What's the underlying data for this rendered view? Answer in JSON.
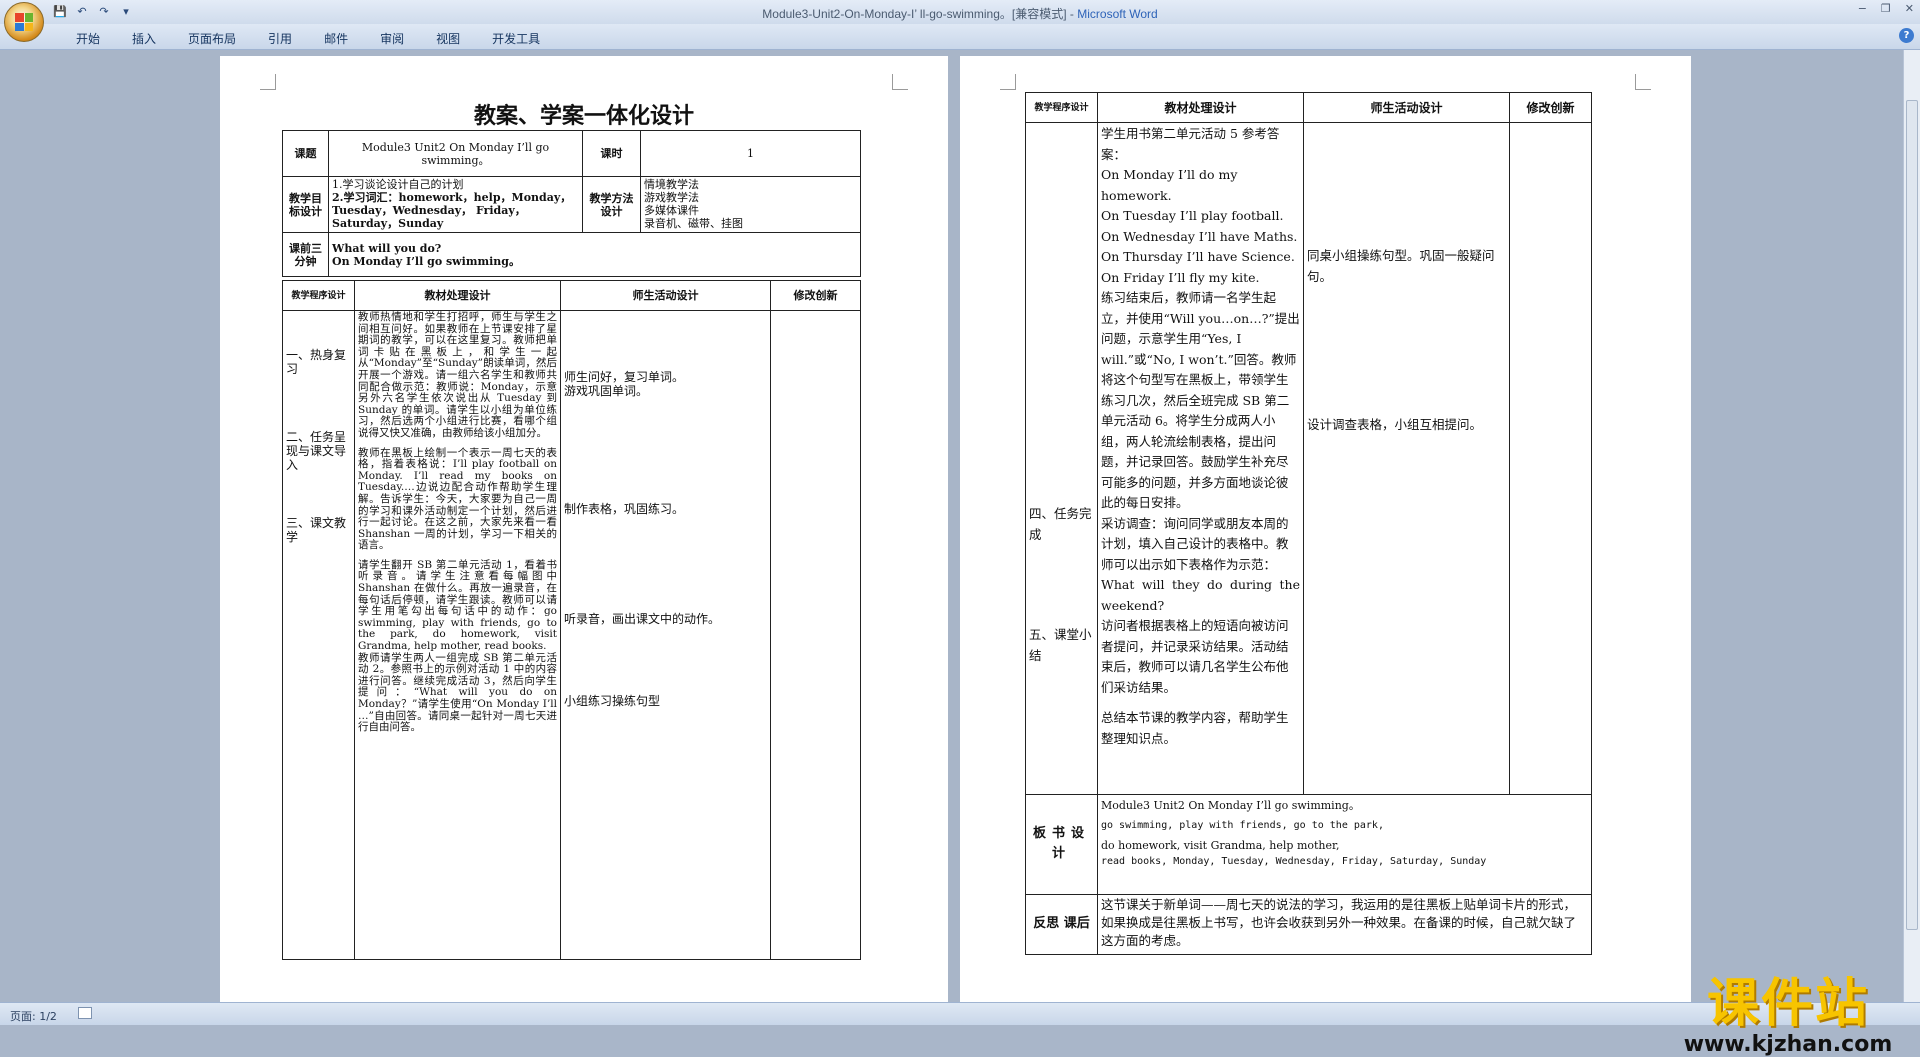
{
  "window": {
    "title": "Module3-Unit2-On-Monday-I’ ll-go-swimming。[兼容模式] - ",
    "app": "Microsoft Word",
    "controls": [
      "−",
      "❐",
      "✕"
    ]
  },
  "qat": {
    "save": "💾",
    "undo": "↶",
    "redo": "↷",
    "more": "▾"
  },
  "ribbon": {
    "tabs": [
      "开始",
      "插入",
      "页面布局",
      "引用",
      "邮件",
      "审阅",
      "视图",
      "开发工具"
    ],
    "help": "?"
  },
  "status": {
    "page": "页面: 1/2"
  },
  "page1": {
    "title": "教案、学案一体化设计",
    "row_lesson": {
      "label": "课题",
      "value": "Module3 Unit2 On Monday I’ll go swimming。",
      "hours_label": "课时",
      "hours": "1"
    },
    "row_goals": {
      "label": "教学目标设计",
      "goal1": "1.学习谈论设计自己的计划",
      "goal2": "2.学习词汇：homework，help，Monday，Tuesday，Wednesday， Friday，Saturday，Sunday",
      "method_label": "教学方法设计",
      "methods": [
        "情境教学法",
        "游戏教学法",
        "多媒体课件",
        "录音机、磁带、挂图"
      ]
    },
    "row_warm": {
      "label": "课前三分钟",
      "line1": "What will you do?",
      "line2": "On Monday I’ll go swimming。"
    },
    "headers": [
      "教学程序设计",
      "教材处理设计",
      "师生活动设计",
      "修改创新"
    ],
    "steps": [
      "一、热身复习",
      "二、任务呈现与课文导入",
      "三、课文教学"
    ],
    "content": [
      "教师热情地和学生打招呼，师生与学生之间相互问好。如果教师在上节课安排了星期词的教学，可以在这里复习。教师把单词卡贴在黑板上，和学生一起从“Monday”至“Sunday”朗读单词，然后开展一个游戏。请一组六名学生和教师共同配合做示范：教师说：Monday，示意另外六名学生依次说出从 Tuesday 到 Sunday 的单词。请学生以小组为单位练习，然后选两个小组进行比赛，看哪个组说得又快又准确，由教师给该小组加分。",
      "教师在黑板上绘制一个表示一周七天的表格，指着表格说：I’ll play football on Monday. I’ll read my books on Tuesday.…边说边配合动作帮助学生理解。告诉学生：今天，大家要为自己一周的学习和课外活动制定一个计划，然后进行一起讨论。在这之前，大家先来看一看 Shanshan 一周的计划，学习一下相关的语言。",
      "请学生翻开 SB 第二单元活动 1，看着书听录音。请学生注意看每幅图中 Shanshan 在做什么。再放一遍录音，在每句话后停顿，请学生跟读。教师可以请学生用笔勾出每句话中的动作：go swimming, play with friends, go to the park, do homework, visit Grandma, help mother, read books.",
      "教师请学生两人一组完成 SB 第二单元活动 2。参照书上的示例对活动 1 中的内容进行问答。继续完成活动 3，然后向学生提问：“What will you do on Monday？”请学生使用“On Monday I’ll …”自由回答。请同桌一起针对一周七天进行自由问答。"
    ],
    "activities": [
      "师生问好，复习单词。",
      "游戏巩固单词。",
      "制作表格，巩固练习。",
      "听录音，画出课文中的动作。",
      "小组练习操练句型"
    ]
  },
  "page2": {
    "headers": [
      "教学程序设计",
      "教材处理设计",
      "师生活动设计",
      "修改创新"
    ],
    "steps": [
      "四、任务完成",
      "五、课堂小结"
    ],
    "content_lines": [
      "学生用书第二单元活动 5 参考答案：",
      "On Monday I’ll do my homework.",
      "On Tuesday I’ll play football.",
      "On Wednesday I’ll have Maths.",
      "On Thursday I’ll have Science.",
      "On Friday I’ll fly my kite.",
      "练习结束后，教师请一名学生起立，并使用“Will you…on…?”提出问题，示意学生用“Yes, I will.”或“No, I won’t.”回答。教师将这个句型写在黑板上，带领学生练习几次，然后全班完成 SB 第二单元活动 6。将学生分成两人小组，两人轮流绘制表格，提出问题，并记录回答。鼓励学生补充尽可能多的问题，并多方面地谈论彼此的每日安排。",
      "采访调查：询问同学或朋友本周的计划，填入自己设计的表格中。教师可以出示如下表格作为示范：",
      "What will they do during the weekend?",
      "访问者根据表格上的短语向被访问者提问，并记录采访结果。活动结束后，教师可以请几名学生公布他们采访结果。",
      "总结本节课的教学内容，帮助学生整理知识点。"
    ],
    "activities": [
      "同桌小组操练句型。巩固一般疑问句。",
      "设计调查表格，小组互相提问。"
    ],
    "board_label": "板书设计",
    "board": [
      "Module3 Unit2 On Monday I’ll go swimming。",
      "go swimming, play with friends, go to the park,",
      "do homework, visit Grandma, help mother,",
      "read books, Monday, Tuesday, Wednesday, Friday, Saturday, Sunday"
    ],
    "reflect_label": "反思 课后",
    "reflect": "这节课关于新单词——周七天的说法的学习，我运用的是往黑板上贴单词卡片的形式，如果换成是往黑板上书写，也许会收获到另外一种效果。在备课的时候，自己就欠缺了这方面的考虑。"
  },
  "watermark": {
    "main": "课件站",
    "url": "www.kjzhan.com"
  },
  "colors": {
    "ribbon": "#dfe8f5",
    "workspace": "#a8b5c8",
    "watermark": "#f7c400",
    "title_app": "#2e63b8"
  }
}
